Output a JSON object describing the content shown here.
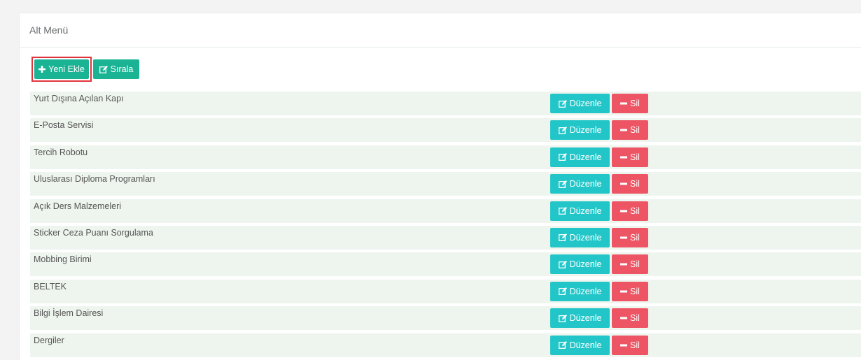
{
  "panel": {
    "title": "Alt Menü"
  },
  "toolbar": {
    "add_label": "Yeni Ekle",
    "sort_label": "Sırala"
  },
  "row_actions": {
    "edit_label": "Düzenle",
    "delete_label": "Sil"
  },
  "items": [
    "Yurt Dışına Açılan Kapı",
    "E-Posta Servisi",
    "Tercih Robotu",
    "Uluslarası Diploma Programları",
    "Açık Ders Malzemeleri",
    "Sticker Ceza Puanı Sorgulama",
    "Mobbing Birimi",
    "BELTEK",
    "Bilgi İşlem Dairesi",
    "Dergiler"
  ],
  "colors": {
    "primary": "#1ab394",
    "info": "#23c6c8",
    "danger": "#ed5565",
    "row_bg": "#eef5ee",
    "highlight_border": "#e0343c"
  },
  "icons": {
    "add": "plus-icon",
    "sort": "edit-icon",
    "edit": "edit-icon",
    "delete": "minus-icon"
  }
}
